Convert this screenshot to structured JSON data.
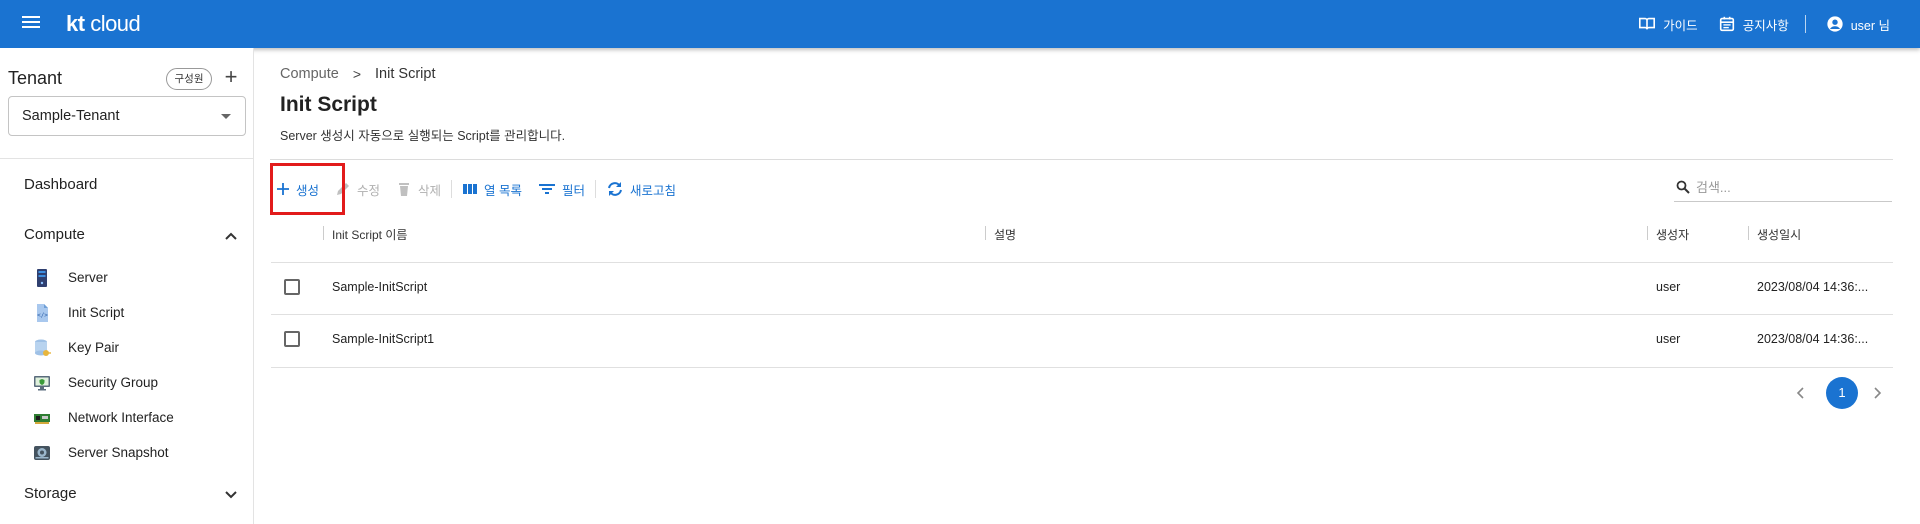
{
  "header": {
    "logo_kt": "kt",
    "logo_cloud": "cloud",
    "guide_label": "가이드",
    "notice_label": "공지사항",
    "user_label": "user 님"
  },
  "sidebar": {
    "tenant_title": "Tenant",
    "member_chip": "구성원",
    "add_icon": "+",
    "tenant_value": "Sample-Tenant",
    "dashboard": "Dashboard",
    "compute_group": "Compute",
    "compute_items": [
      {
        "label": "Server",
        "icon": "server-icon"
      },
      {
        "label": "Init Script",
        "icon": "script-icon"
      },
      {
        "label": "Key Pair",
        "icon": "key-icon"
      },
      {
        "label": "Security Group",
        "icon": "security-group-icon"
      },
      {
        "label": "Network Interface",
        "icon": "network-card-icon"
      },
      {
        "label": "Server Snapshot",
        "icon": "snapshot-icon"
      }
    ],
    "storage_group": "Storage"
  },
  "breadcrumb": {
    "parent": "Compute",
    "separator": ">",
    "current": "Init Script"
  },
  "page": {
    "title": "Init Script",
    "description": "Server 생성시 자동으로 실행되는 Script를 관리합니다."
  },
  "toolbar": {
    "create": "생성",
    "edit": "수정",
    "delete": "삭제",
    "columns": "열 목록",
    "filter": "필터",
    "refresh": "새로고침"
  },
  "search": {
    "placeholder": "검색..."
  },
  "table": {
    "headers": [
      "Init Script 이름",
      "설명",
      "생성자",
      "생성일시"
    ],
    "rows": [
      {
        "name": "Sample-InitScript",
        "description": "",
        "creator": "user",
        "created": "2023/08/04 14:36:..."
      },
      {
        "name": "Sample-InitScript1",
        "description": "",
        "creator": "user",
        "created": "2023/08/04 14:36:..."
      }
    ]
  },
  "pagination": {
    "current": "1"
  },
  "colors": {
    "primary": "#1a73d1",
    "highlight": "#e21b1b",
    "disabled": "#b0b0b0"
  }
}
